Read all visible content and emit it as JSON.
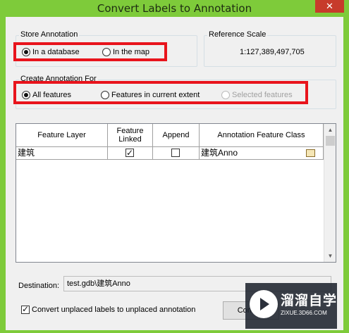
{
  "window": {
    "title": "Convert Labels to Annotation",
    "close_glyph": "✕"
  },
  "store_annotation": {
    "legend": "Store Annotation",
    "options": [
      {
        "label": "In a database",
        "selected": true
      },
      {
        "label": "In the map",
        "selected": false
      }
    ]
  },
  "reference_scale": {
    "legend": "Reference Scale",
    "value": "1:127,389,497,705"
  },
  "create_for": {
    "legend": "Create Annotation For",
    "options": [
      {
        "label": "All features",
        "selected": true,
        "enabled": true
      },
      {
        "label": "Features in current extent",
        "selected": false,
        "enabled": true
      },
      {
        "label": "Selected features",
        "selected": false,
        "enabled": false
      }
    ]
  },
  "table": {
    "columns": [
      "Feature Layer",
      "Feature Linked",
      "Append",
      "Annotation Feature Class"
    ],
    "rows": [
      {
        "feature_layer": "建筑",
        "feature_linked": true,
        "append": false,
        "annotation_class": "建筑Anno"
      }
    ]
  },
  "destination": {
    "label": "Destination:",
    "value": "test.gdb\\建筑Anno"
  },
  "convert_unplaced": {
    "label": "Convert unplaced labels to unplaced annotation",
    "checked": true
  },
  "buttons": {
    "convert": "Convert"
  },
  "watermark": {
    "title": "溜溜自学",
    "subtitle": "ZIXUE.3D66.COM"
  },
  "colors": {
    "highlight": "#e8141c",
    "titlebar": "#7ecb3a"
  }
}
